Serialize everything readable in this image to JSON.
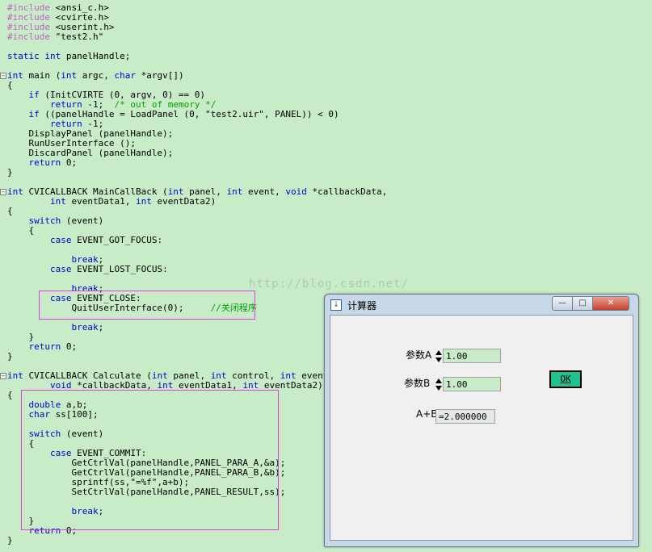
{
  "code": {
    "lines": [
      "#include <ansi_c.h>",
      "#include <cvirte.h>",
      "#include <userint.h>",
      "#include \"test2.h\"",
      "",
      "static int panelHandle;",
      "",
      "int main (int argc, char *argv[])",
      "{",
      "    if (InitCVIRTE (0, argv, 0) == 0)",
      "        return -1;  /* out of memory */",
      "    if ((panelHandle = LoadPanel (0, \"test2.uir\", PANEL)) < 0)",
      "        return -1;",
      "    DisplayPanel (panelHandle);",
      "    RunUserInterface ();",
      "    DiscardPanel (panelHandle);",
      "    return 0;",
      "}",
      "",
      "int CVICALLBACK MainCallBack (int panel, int event, void *callbackData,",
      "        int eventData1, int eventData2)",
      "{",
      "    switch (event)",
      "    {",
      "        case EVENT_GOT_FOCUS:",
      "",
      "            break;",
      "        case EVENT_LOST_FOCUS:",
      "",
      "            break;",
      "        case EVENT_CLOSE:",
      "            QuitUserInterface(0);     //关闭程序",
      "",
      "            break;",
      "    }",
      "    return 0;",
      "}",
      "",
      "int CVICALLBACK Calculate (int panel, int control, int event,",
      "        void *callbackData, int eventData1, int eventData2)",
      "{",
      "    double a,b;",
      "    char ss[100];",
      "",
      "    switch (event)",
      "    {",
      "        case EVENT_COMMIT:",
      "            GetCtrlVal(panelHandle,PANEL_PARA_A,&a);",
      "            GetCtrlVal(panelHandle,PANEL_PARA_B,&b);",
      "            sprintf(ss,\"=%f\",a+b);",
      "            SetCtrlVal(panelHandle,PANEL_RESULT,ss);",
      "",
      "            break;",
      "    }",
      "    return 0;",
      "}"
    ],
    "watermark": "http://blog.csdn.net/"
  },
  "calculator": {
    "title": "计算器",
    "param_a_label": "参数A",
    "param_a_value": "1.00",
    "param_b_label": "参数B",
    "param_b_value": "1.00",
    "result_label": "A+B",
    "result_value": "=2.000000",
    "ok_label": "OK",
    "min_glyph": "—",
    "max_glyph": "□",
    "close_glyph": "✕"
  },
  "colors": {
    "editor_bg": "#c8ecc8",
    "keyword": "#0000d0",
    "comment": "#00a000",
    "preprocessor": "#c060c0",
    "highlight_box": "#e040e0",
    "ok_button": "#20c090"
  }
}
